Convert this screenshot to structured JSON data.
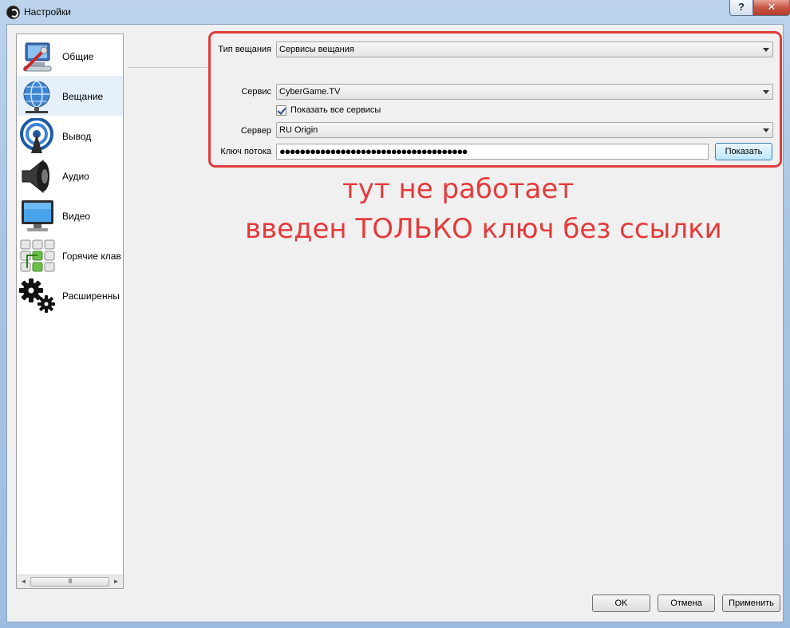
{
  "window": {
    "title": "Настройки",
    "help": "?",
    "close": "✕"
  },
  "sidebar": {
    "items": [
      {
        "label": "Общие",
        "icon": "general-settings-icon"
      },
      {
        "label": "Вещание",
        "icon": "broadcast-globe-icon",
        "active": true
      },
      {
        "label": "Вывод",
        "icon": "output-signal-icon"
      },
      {
        "label": "Аудио",
        "icon": "speaker-icon"
      },
      {
        "label": "Видео",
        "icon": "monitor-icon"
      },
      {
        "label": "Горячие клав",
        "icon": "hotkeys-keyboard-icon"
      },
      {
        "label": "Расширенны",
        "icon": "gears-icon"
      }
    ],
    "scroll_left": "◄",
    "scroll_right": "►",
    "scroll_thumb": "III"
  },
  "form": {
    "stream_type": {
      "label": "Тип вещания",
      "value": "Сервисы вещания"
    },
    "service": {
      "label": "Сервис",
      "value": "CyberGame.TV"
    },
    "show_all": {
      "label": "Показать все сервисы",
      "checked": true
    },
    "server": {
      "label": "Сервер",
      "value": "RU Origin"
    },
    "stream_key": {
      "label": "Ключ потока",
      "value": "●●●●●●●●●●●●●●●●●●●●●●●●●●●●●●●●●●●●●"
    },
    "show_button": "Показать"
  },
  "annotation": {
    "line1": "тут не работает",
    "line2": "введен ТОЛЬКО ключ без ссылки",
    "color": "#e63a3a"
  },
  "footer": {
    "ok": "OK",
    "cancel": "Отмена",
    "apply": "Применить"
  }
}
